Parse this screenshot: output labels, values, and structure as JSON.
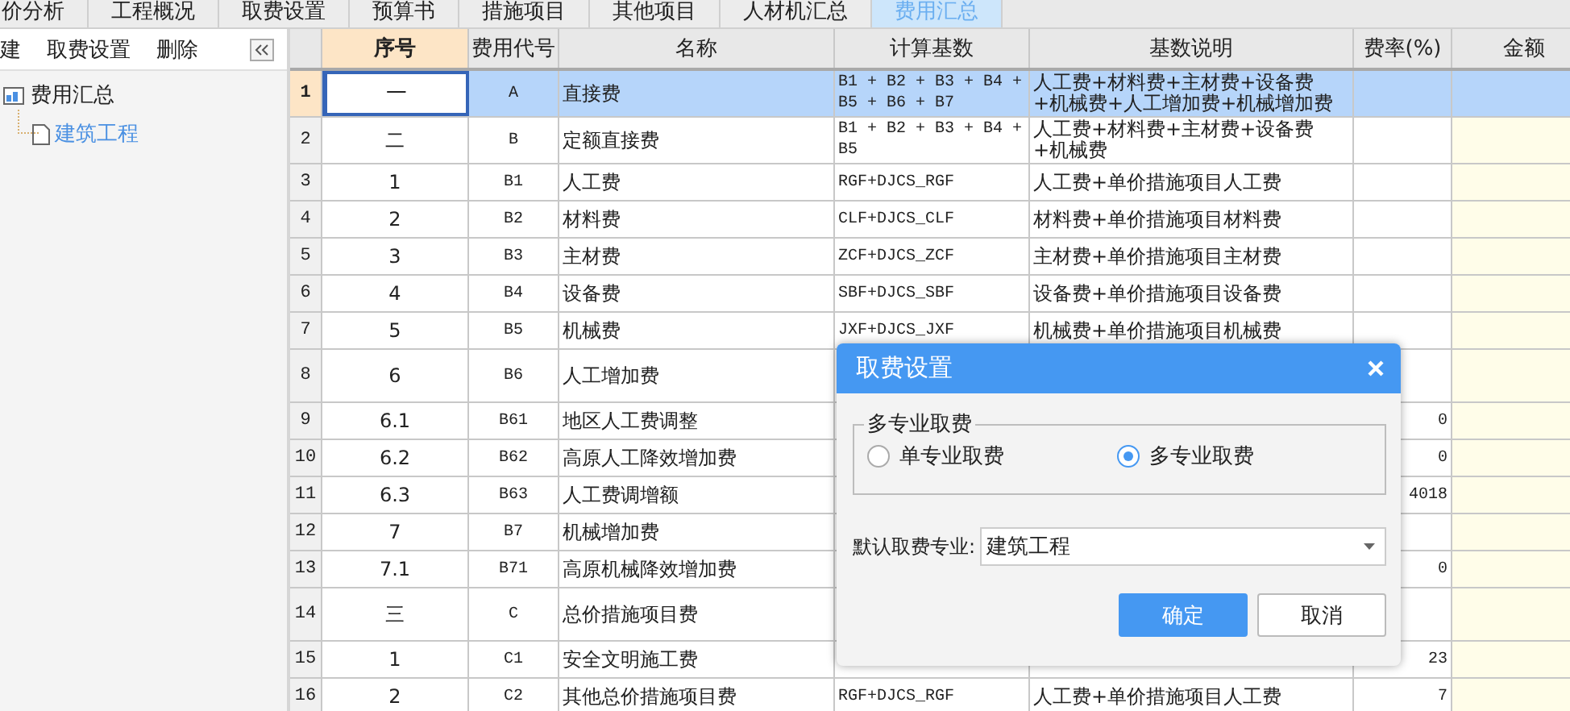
{
  "tabs": [
    {
      "label": "价分析",
      "selected": false
    },
    {
      "label": "工程概况",
      "selected": false
    },
    {
      "label": "取费设置",
      "selected": false
    },
    {
      "label": "预算书",
      "selected": false
    },
    {
      "label": "措施项目",
      "selected": false
    },
    {
      "label": "其他项目",
      "selected": false
    },
    {
      "label": "人材机汇总",
      "selected": false
    },
    {
      "label": "费用汇总",
      "selected": true
    }
  ],
  "toolbar": {
    "buttons": [
      "建",
      "取费设置",
      "删除"
    ]
  },
  "tree": [
    {
      "label": "费用汇总",
      "selected": false,
      "children": [
        {
          "label": "建筑工程",
          "selected": true
        }
      ]
    }
  ],
  "table": {
    "columns": [
      {
        "label": "序号",
        "selected": true
      },
      {
        "label": "费用代号",
        "selected": false
      },
      {
        "label": "名称",
        "selected": false
      },
      {
        "label": "计算基数",
        "selected": false
      },
      {
        "label": "基数说明",
        "selected": false
      },
      {
        "label": "费率(%)",
        "selected": false
      },
      {
        "label": "金额",
        "selected": false
      }
    ],
    "rows": [
      {
        "num": "1",
        "seq": "一",
        "code": "A",
        "name": "直接费",
        "base": "B1 + B2 + B3 + B4 + B5 + B6 + B7",
        "desc": "人工费+材料费+主材费+设备费+机械费+人工增加费+机械增加费",
        "selected": true
      },
      {
        "num": "2",
        "seq": "二",
        "code": "B",
        "name": "定额直接费",
        "base": "B1 + B2 + B3 + B4 + B5",
        "desc": "人工费+材料费+主材费+设备费+机械费",
        "selected": false
      },
      {
        "num": "3",
        "seq": "1",
        "code": "B1",
        "name": "人工费",
        "base": "RGF+DJCS_RGF",
        "desc": "人工费+单价措施项目人工费",
        "selected": false
      },
      {
        "num": "4",
        "seq": "2",
        "code": "B2",
        "name": "材料费",
        "base": "CLF+DJCS_CLF",
        "desc": "材料费+单价措施项目材料费",
        "selected": false
      },
      {
        "num": "5",
        "seq": "3",
        "code": "B3",
        "name": "主材费",
        "base": "ZCF+DJCS_ZCF",
        "desc": "主材费+单价措施项目主材费",
        "selected": false
      },
      {
        "num": "6",
        "seq": "4",
        "code": "B4",
        "name": "设备费",
        "base": "SBF+DJCS_SBF",
        "desc": "设备费+单价措施项目设备费",
        "selected": false
      },
      {
        "num": "7",
        "seq": "5",
        "code": "B5",
        "name": "机械费",
        "base": "JXF+DJCS_JXF",
        "desc": "机械费+单价措施项目机械费",
        "selected": false
      },
      {
        "num": "8",
        "seq": "6",
        "code": "B6",
        "name": "人工增加费",
        "tall": true,
        "selected": false
      },
      {
        "num": "9",
        "seq": "6.1",
        "code": "B61",
        "name": "地区人工费调整",
        "rate": "0",
        "selected": false
      },
      {
        "num": "10",
        "seq": "6.2",
        "code": "B62",
        "name": "高原人工降效增加费",
        "rate": "0",
        "selected": false
      },
      {
        "num": "11",
        "seq": "6.3",
        "code": "B63",
        "name": "人工费调增额",
        "rate": "4018",
        "selected": false
      },
      {
        "num": "12",
        "seq": "7",
        "code": "B7",
        "name": "机械增加费",
        "selected": false
      },
      {
        "num": "13",
        "seq": "7.1",
        "code": "B71",
        "name": "高原机械降效增加费",
        "rate": "0",
        "selected": false
      },
      {
        "num": "14",
        "seq": "三",
        "code": "C",
        "name": "总价措施项目费",
        "tall": true,
        "selected": false
      },
      {
        "num": "15",
        "seq": "1",
        "code": "C1",
        "name": "安全文明施工费",
        "rate": "23",
        "selected": false
      },
      {
        "num": "16",
        "seq": "2",
        "code": "C2",
        "name": "其他总价措施项目费",
        "base": "RGF+DJCS_RGF",
        "desc": "人工费+单价措施项目人工费",
        "rate": "7",
        "selected": false
      }
    ]
  },
  "dialog": {
    "title": "取费设置",
    "group": {
      "legend": "多专业取费",
      "options": [
        {
          "label": "单专业取费",
          "selected": false
        },
        {
          "label": "多专业取费",
          "selected": true
        }
      ]
    },
    "default_label": "默认取费专业:",
    "default_value": "建筑工程",
    "buttons": [
      {
        "label": "确定",
        "kind": "primary"
      },
      {
        "label": "取消",
        "kind": "secondary"
      }
    ]
  }
}
